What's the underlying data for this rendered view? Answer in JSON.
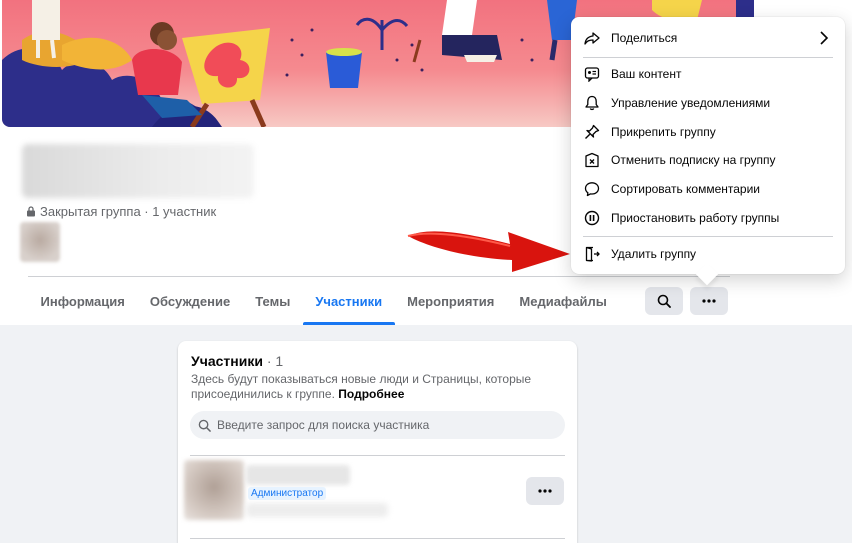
{
  "group": {
    "privacy_text": "Закрытая группа · 1 участник"
  },
  "tabs": [
    {
      "label": "Информация"
    },
    {
      "label": "Обсуждение"
    },
    {
      "label": "Темы"
    },
    {
      "label": "Участники"
    },
    {
      "label": "Мероприятия"
    },
    {
      "label": "Медиафайлы"
    }
  ],
  "active_tab": "Участники",
  "members_card": {
    "title": "Участники",
    "count": " · 1",
    "description": "Здесь будут показываться новые люди и Страницы, которые присоединились к группе.",
    "more_link": "Подробнее",
    "search_placeholder": "Введите запрос для поиска участника",
    "member_role": "Администратор"
  },
  "menu": {
    "items": [
      {
        "label": "Поделиться",
        "icon": "share-icon"
      },
      {
        "label": "Ваш контент",
        "icon": "content-icon"
      },
      {
        "label": "Управление уведомлениями",
        "icon": "bell-icon"
      },
      {
        "label": "Прикрепить группу",
        "icon": "pin-icon"
      },
      {
        "label": "Отменить подписку на группу",
        "icon": "unfollow-icon"
      },
      {
        "label": "Сортировать комментарии",
        "icon": "comment-icon"
      },
      {
        "label": "Приостановить работу группы",
        "icon": "pause-icon"
      },
      {
        "label": "Удалить группу",
        "icon": "exit-icon"
      }
    ]
  },
  "colors": {
    "accent": "#1877f2",
    "annotation_arrow": "#d9140e"
  }
}
